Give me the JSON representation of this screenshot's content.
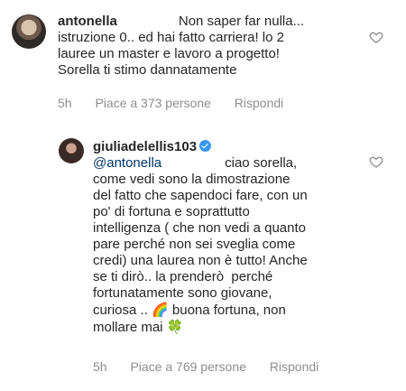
{
  "comments": [
    {
      "username": "antonella",
      "text_lines": [
        "Non saper far nulla...",
        "istruzione 0.. ed hai fatto carriera! lo 2",
        "lauree un master e lavoro a progetto!",
        "Sorella ti stimo dannatamente"
      ],
      "time": "5h",
      "likes": "Piace a 373 persone",
      "reply": "Rispondi"
    },
    {
      "username": "giuliadelellis103",
      "verified": true,
      "mention": "@antonella",
      "text_lines": [
        "ciao sorella,",
        "come vedi sono la dimostrazione",
        "del fatto che sapendoci fare, con un",
        "po' di fortuna e soprattutto",
        "intelligenza ( che non vedi a quanto",
        "pare perché non sei sveglia come",
        "credi) una laurea non è tutto! Anche",
        "se ti dirò.. la prenderò  perché",
        "fortunatamente sono giovane,",
        "curiosa ..",
        "buona fortuna, non",
        "mollare mai"
      ],
      "emojis": [
        "rainbow-emoji",
        "four-leaf-clover-emoji"
      ],
      "time": "5h",
      "likes": "Piace a 769 persone",
      "reply": "Rispondi"
    }
  ],
  "colors": {
    "text": "#262626",
    "meta": "#8e8e8e",
    "mention": "#00376b",
    "verified": "#3897f0"
  }
}
